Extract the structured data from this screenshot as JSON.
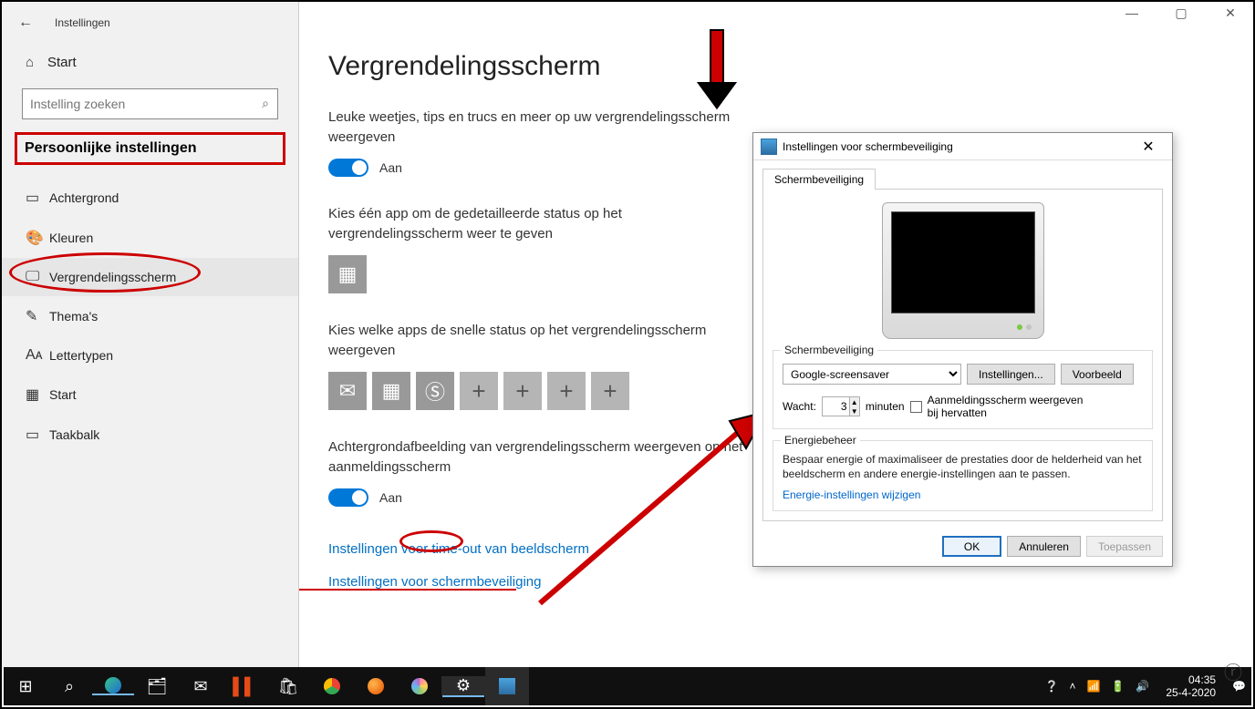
{
  "window": {
    "app_title": "Instellingen",
    "controls": {
      "min": "—",
      "max": "▢",
      "close": "✕"
    }
  },
  "sidebar": {
    "home": "Start",
    "search_placeholder": "Instelling zoeken",
    "category": "Persoonlijke instellingen",
    "items": [
      {
        "icon": "▭",
        "label": "Achtergrond"
      },
      {
        "icon": "🎨",
        "label": "Kleuren"
      },
      {
        "icon": "🖵",
        "label": "Vergrendelingsscherm",
        "selected": true,
        "circled": true
      },
      {
        "icon": "✎",
        "label": "Thema's"
      },
      {
        "icon": "Aᴀ",
        "label": "Lettertypen"
      },
      {
        "icon": "▦",
        "label": "Start"
      },
      {
        "icon": "▭",
        "label": "Taakbalk"
      }
    ]
  },
  "page": {
    "title": "Vergrendelingsscherm",
    "toggle1": {
      "desc": "Leuke weetjes, tips en trucs en meer op uw vergrendelingsscherm weergeven",
      "state": "Aan"
    },
    "detail_status": {
      "desc": "Kies één app om de gedetailleerde status op het vergrendelingsscherm weer te geven"
    },
    "quick_status": {
      "desc": "Kies welke apps de snelle status op het vergrendelingsscherm weergeven"
    },
    "toggle2": {
      "desc": "Achtergrondafbeelding van vergrendelingsscherm weergeven op het aanmeldingsscherm",
      "state": "Aan"
    },
    "link_timeout": "Instellingen voor time-out van beeldscherm",
    "link_screensaver": "Instellingen voor schermbeveiliging"
  },
  "dialog": {
    "title": "Instellingen voor schermbeveiliging",
    "tab": "Schermbeveiliging",
    "group_screensaver": "Schermbeveiliging",
    "dropdown_value": "Google-screensaver",
    "btn_settings": "Instellingen...",
    "btn_preview": "Voorbeeld",
    "wait_label": "Wacht:",
    "wait_value": "3",
    "wait_unit": "minuten",
    "resume_label": "Aanmeldingsscherm weergeven bij hervatten",
    "group_power": "Energiebeheer",
    "power_desc": "Bespaar energie of maximaliseer de prestaties door de helderheid van het beeldscherm en andere energie-instellingen aan te passen.",
    "power_link": "Energie-instellingen wijzigen",
    "ok": "OK",
    "cancel": "Annuleren",
    "apply": "Toepassen"
  },
  "taskbar": {
    "time": "04:35",
    "date": "25-4-2020"
  }
}
